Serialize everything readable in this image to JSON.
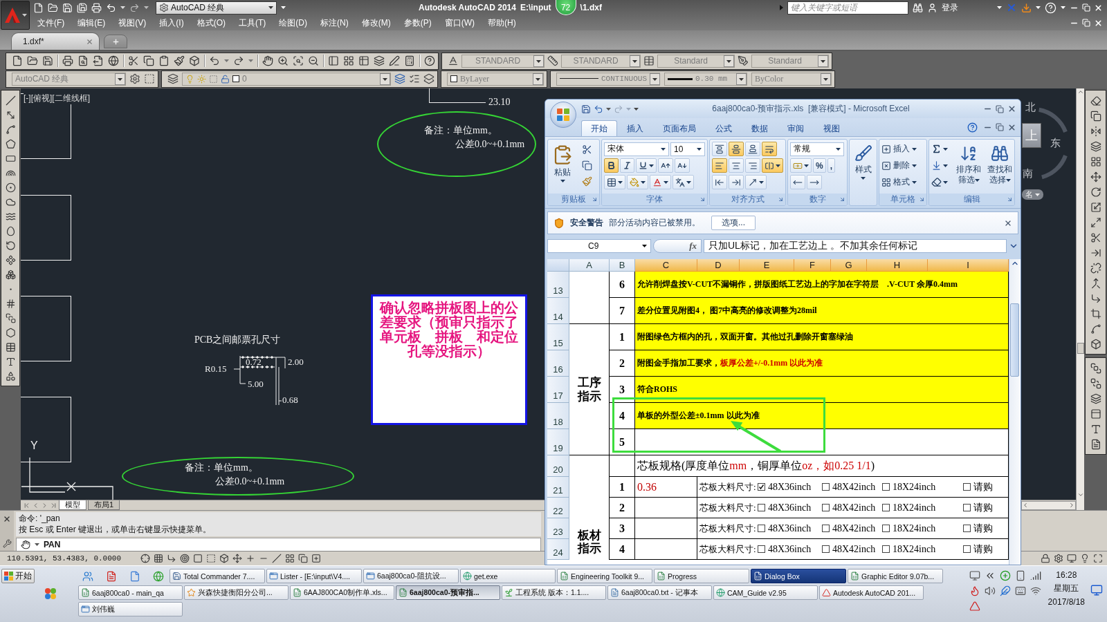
{
  "autocad": {
    "title": "Autodesk AutoCAD 2014",
    "path": [
      "E:\\input",
      "\\1.dxf"
    ],
    "badge": "72",
    "workspace": "AutoCAD 经典",
    "search": {
      "placeholder": "键入关键字或短语"
    },
    "login": "登录",
    "menu": [
      "文件(F)",
      "编辑(E)",
      "视图(V)",
      "插入(I)",
      "格式(O)",
      "工具(T)",
      "绘图(D)",
      "标注(N)",
      "修改(M)",
      "参数(P)",
      "窗口(W)",
      "帮助(H)"
    ],
    "tabs": [
      {
        "label": "1.dxf*",
        "selected": true
      }
    ],
    "styles": [
      "STANDARD",
      "STANDARD",
      "Standard",
      "Standard"
    ],
    "workspace_toolbar": "AutoCAD 经典",
    "layer": "0",
    "color_control": "ByLayer",
    "linetype": "CONTINUOUS",
    "lineweight": "0.30 mm",
    "plot_style": "ByColor"
  },
  "canvas": {
    "viewport_label": "[-][俯视][二维线框]",
    "dimension": "23.10",
    "notes": [
      {
        "lines": [
          "备注：单位mm。",
          "公差0.0~+0.1mm"
        ]
      },
      {
        "lines": [
          "备注：单位mm。",
          "公差0.0~+0.1mm"
        ]
      }
    ],
    "pcb_title": "PCB之间邮票孔尺寸",
    "pcb_dimensions": [
      "R0.15",
      "0.72",
      "2.00",
      "5.00",
      "0.68"
    ],
    "comment": "确认忽略拼板图上的公差要求（预审只指示了单元板　拼板　和定位孔等没指示）",
    "ucs_label": "Y",
    "viewcube": {
      "labels": [
        "北",
        "上",
        "东",
        "南"
      ],
      "menu": "名"
    },
    "layout_tabs": [
      {
        "label": "模型",
        "selected": true
      },
      {
        "label": "布局1",
        "selected": false
      }
    ]
  },
  "command": {
    "history": [
      "命令: '_pan",
      "按 Esc 或 Enter 键退出，或单击右键显示快捷菜单。"
    ],
    "input": "PAN"
  },
  "status_bar": {
    "coordinates": "110.5391, 53.4383, 0.0000"
  },
  "excel": {
    "title": "6aaj800ca0-预审指示.xls  [兼容模式] - Microsoft Excel",
    "tabs": [
      {
        "label": "开始",
        "selected": true
      },
      {
        "label": "插入",
        "selected": false
      },
      {
        "label": "页面布局",
        "selected": false
      },
      {
        "label": "公式",
        "selected": false
      },
      {
        "label": "数据",
        "selected": false
      },
      {
        "label": "审阅",
        "selected": false
      },
      {
        "label": "视图",
        "selected": false
      }
    ],
    "ribbon": [
      {
        "kind": "clipboard",
        "label": "剪贴板",
        "paste": "粘贴"
      },
      {
        "kind": "font",
        "label": "字体",
        "font": "宋体",
        "size": "10",
        "bold": true,
        "italic": false,
        "underline": false
      },
      {
        "kind": "alignment",
        "label": "对齐方式",
        "align_top": false,
        "align_middle": true,
        "align_bottom": false,
        "align_left": true,
        "align_center": false,
        "align_right": false,
        "wrap": true,
        "merge": true
      },
      {
        "kind": "number",
        "label": "数字",
        "format": "常规",
        "percent": "%",
        "comma": ","
      },
      {
        "kind": "styles",
        "button": "样式"
      },
      {
        "kind": "cells",
        "label": "单元格",
        "buttons": [
          "插入",
          "删除",
          "格式"
        ]
      },
      {
        "kind": "editing",
        "label": "编辑",
        "buttons": [
          "排序和筛选",
          "查找和选择"
        ]
      }
    ],
    "security": {
      "title": "安全警告",
      "message": "部分活动内容已被禁用。",
      "button": "选项..."
    },
    "name_box": "C9",
    "function_label": "fx",
    "formula": "只加UL标记，加在工艺边上 。不加其余任何标记",
    "columns": [
      {
        "label": "A",
        "selected": false
      },
      {
        "label": "B",
        "selected": false
      },
      {
        "label": "C",
        "selected": true
      },
      {
        "label": "D",
        "selected": true
      },
      {
        "label": "E",
        "selected": true
      },
      {
        "label": "F",
        "selected": true
      },
      {
        "label": "G",
        "selected": true
      },
      {
        "label": "H",
        "selected": true
      },
      {
        "label": "I",
        "selected": true
      }
    ],
    "groups": [
      {
        "open_end": false,
        "rows": [
          {
            "number": "13",
            "kind": "note",
            "index": "6",
            "highlighted": true,
            "text": [
              {
                "text": "允许削焊盘按V-CUT不漏铜作，拼版图纸工艺边上的字加在字符层　.V-CUT 余厚0.4mm"
              }
            ]
          },
          {
            "number": "14",
            "kind": "note",
            "index": "7",
            "highlighted": true,
            "text": [
              {
                "text": "差分位置见附图4， 图7中高亮的修改调整为28mil"
              }
            ]
          }
        ]
      },
      {
        "label": "工序指示",
        "open_end": false,
        "rows": [
          {
            "number": "15",
            "kind": "note",
            "index": "1",
            "highlighted": true,
            "text": [
              {
                "text": "附图绿色方框内的孔，双面开窗。其他过孔删除开窗塞绿油"
              }
            ]
          },
          {
            "number": "16",
            "kind": "note",
            "index": "2",
            "highlighted": true,
            "text": [
              {
                "text": "附图金手指加工要求，"
              },
              {
                "text": "板厚公差+/-0.1mm 以此为准",
                "color": "#cc0000"
              }
            ]
          },
          {
            "number": "17",
            "kind": "note",
            "index": "3",
            "highlighted": true,
            "text": [
              {
                "text": "符合ROHS"
              }
            ]
          },
          {
            "number": "18",
            "kind": "note",
            "index": "4",
            "highlighted": true,
            "text": [
              {
                "text": "单板的外型公差±0.1mm 以此为准"
              }
            ]
          },
          {
            "number": "19",
            "kind": "note",
            "index": "5",
            "highlighted": false
          }
        ]
      },
      {
        "label": "板材指示",
        "open_end": true,
        "rows": [
          {
            "number": "20",
            "kind": "heading",
            "text": [
              {
                "text": "芯板规格(厚度单位"
              },
              {
                "text": "mm",
                "color": "#cc0000"
              },
              {
                "text": "，铜厚单位"
              },
              {
                "text": "oz，如0.25 1/1",
                "color": "#cc0000"
              },
              {
                "text": ")"
              }
            ]
          },
          {
            "number": "21",
            "kind": "spec",
            "index": "1",
            "value": "0.36",
            "label": "芯板大料尺寸:",
            "options": [
              {
                "label": "48X36inch",
                "checked": true
              },
              {
                "label": "48X42inch",
                "checked": false
              },
              {
                "label": "18X24inch",
                "checked": false
              },
              {
                "label": "请购",
                "checked": false
              }
            ]
          },
          {
            "number": "22",
            "kind": "spec",
            "index": "2",
            "label": "芯板大料尺寸:",
            "options": [
              {
                "label": "48X36inch",
                "checked": false
              },
              {
                "label": "48X42inch",
                "checked": false
              },
              {
                "label": "18X24inch",
                "checked": false
              },
              {
                "label": "请购",
                "checked": false
              }
            ]
          },
          {
            "number": "23",
            "kind": "spec",
            "index": "3",
            "label": "芯板大料尺寸:",
            "options": [
              {
                "label": "48X36inch",
                "checked": false
              },
              {
                "label": "48X42inch",
                "checked": false
              },
              {
                "label": "18X24inch",
                "checked": false
              },
              {
                "label": "请购",
                "checked": false
              }
            ]
          },
          {
            "number": "24",
            "kind": "spec",
            "index": "4",
            "label": "芯板大料尺寸:",
            "options": [
              {
                "label": "48X36inch",
                "checked": false
              },
              {
                "label": "48X42inch",
                "checked": false
              },
              {
                "label": "18X24inch",
                "checked": false
              },
              {
                "label": "请购",
                "checked": false
              }
            ]
          }
        ]
      }
    ]
  },
  "taskbar": {
    "start": "开始",
    "buttons": [
      {
        "label": "Total Commander 7....",
        "kind": "disk",
        "selected": false,
        "flashing": false
      },
      {
        "label": "Lister - [E:\\input\\V4....",
        "kind": "window",
        "selected": false,
        "flashing": false
      },
      {
        "label": "6aaj800ca0-阻抗设...",
        "kind": "window",
        "selected": false,
        "flashing": false
      },
      {
        "label": "get.exe",
        "kind": "globe",
        "selected": false,
        "flashing": false
      },
      {
        "label": "Engineering Toolkit 9...",
        "kind": "sheet",
        "selected": false,
        "flashing": false
      },
      {
        "label": "Progress",
        "kind": "sheet",
        "selected": false,
        "flashing": false
      },
      {
        "label": "Dialog Box",
        "kind": "sheet",
        "selected": false,
        "flashing": true
      },
      {
        "label": "Graphic Editor 9.07b...",
        "kind": "sheet",
        "selected": false,
        "flashing": false
      },
      {
        "label": "6aaj800ca0 - main_qa",
        "kind": "sheet",
        "selected": false,
        "flashing": false
      },
      {
        "label": "兴森快捷衡阳分公司...",
        "kind": "star",
        "selected": false,
        "flashing": false
      },
      {
        "label": "6AAJ800CA0制作单.xls...",
        "kind": "sheet",
        "selected": false,
        "flashing": false
      },
      {
        "label": "6aaj800ca0-预审指...",
        "kind": "sheet",
        "selected": true,
        "flashing": false
      },
      {
        "label": "工程系统  版本：1.1....",
        "kind": "sprout",
        "selected": false,
        "flashing": false
      },
      {
        "label": "6aaj800ca0.txt - 记事本",
        "kind": "note",
        "selected": false,
        "flashing": false
      },
      {
        "label": "CAM_Guide v2.95",
        "kind": "globe",
        "selected": false,
        "flashing": false
      },
      {
        "label": "Autodesk AutoCAD 201...",
        "kind": "triangle",
        "selected": false,
        "flashing": false
      },
      {
        "label": "刘伟巍",
        "kind": "window",
        "selected": false,
        "flashing": false
      }
    ],
    "clock": {
      "time": "16:28",
      "weekday": "星期五",
      "date": "2017/8/18"
    }
  }
}
